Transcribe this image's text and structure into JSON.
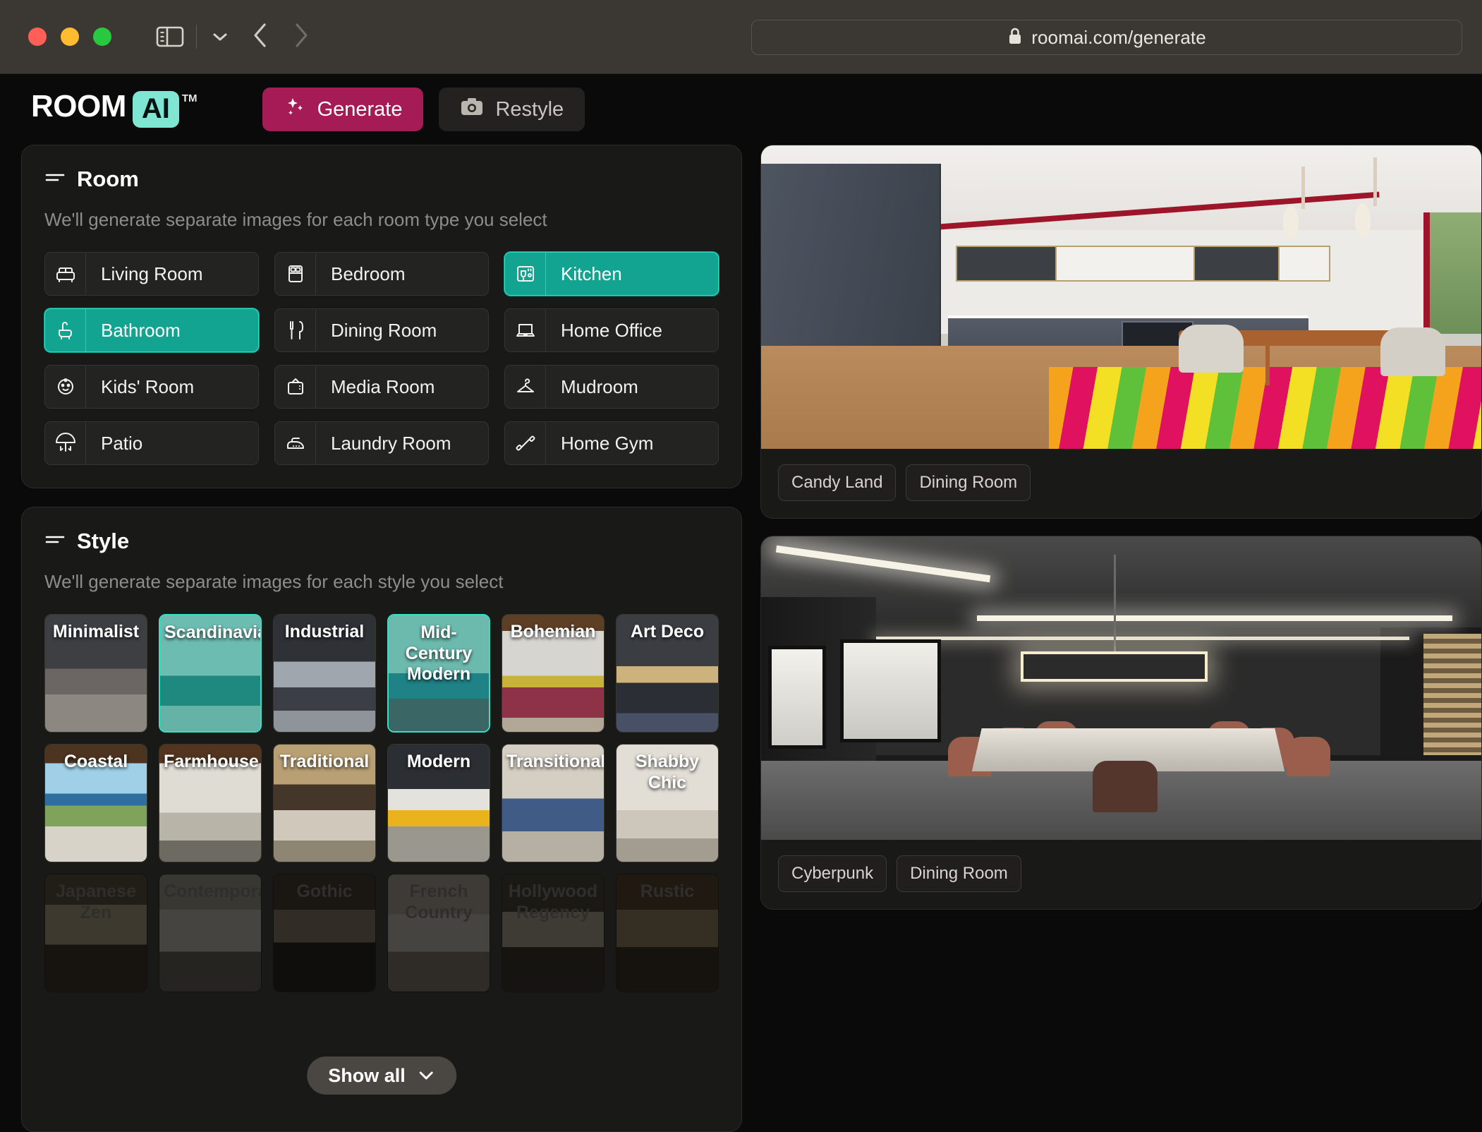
{
  "browser": {
    "url": "roomai.com/generate",
    "lock_icon": "lock-icon",
    "back_icon": "chevron-left-icon",
    "forward_icon": "chevron-right-icon",
    "sidebar_icon": "sidebar-toggle-icon",
    "dropdown_icon": "chevron-down-icon"
  },
  "header": {
    "logo_word": "ROOM",
    "logo_badge": "AI",
    "logo_tm": "TM",
    "tabs": [
      {
        "label": "Generate",
        "icon": "sparkles-icon",
        "active": true
      },
      {
        "label": "Restyle",
        "icon": "camera-icon",
        "active": false
      }
    ]
  },
  "room_section": {
    "title": "Room",
    "icon": "list-lines-icon",
    "subtitle": "We'll generate separate images for each room type you select",
    "items": [
      {
        "label": "Living Room",
        "icon": "sofa-icon",
        "selected": false
      },
      {
        "label": "Bedroom",
        "icon": "bed-icon",
        "selected": false
      },
      {
        "label": "Kitchen",
        "icon": "kitchen-icon",
        "selected": true
      },
      {
        "label": "Bathroom",
        "icon": "bathtub-icon",
        "selected": true
      },
      {
        "label": "Dining Room",
        "icon": "cutlery-icon",
        "selected": false
      },
      {
        "label": "Home Office",
        "icon": "laptop-icon",
        "selected": false
      },
      {
        "label": "Kids' Room",
        "icon": "baby-icon",
        "selected": false
      },
      {
        "label": "Media Room",
        "icon": "tv-icon",
        "selected": false
      },
      {
        "label": "Mudroom",
        "icon": "hanger-icon",
        "selected": false
      },
      {
        "label": "Patio",
        "icon": "parasol-icon",
        "selected": false
      },
      {
        "label": "Laundry Room",
        "icon": "iron-icon",
        "selected": false
      },
      {
        "label": "Home Gym",
        "icon": "dumbbell-icon",
        "selected": false
      }
    ]
  },
  "style_section": {
    "title": "Style",
    "icon": "list-lines-icon",
    "subtitle": "We'll generate separate images for each style you select",
    "show_all": {
      "label": "Show all",
      "icon": "chevron-down-icon"
    },
    "rows": [
      {
        "dimmed": false,
        "items": [
          {
            "label": "Minimalist",
            "selected": false,
            "art": "minimalist"
          },
          {
            "label": "Scandinavian",
            "selected": true,
            "art": "scandinavian"
          },
          {
            "label": "Industrial",
            "selected": false,
            "art": "industrial"
          },
          {
            "label": "Mid-Century Modern",
            "selected": true,
            "art": "midcentury"
          },
          {
            "label": "Bohemian",
            "selected": false,
            "art": "bohemian"
          },
          {
            "label": "Art Deco",
            "selected": false,
            "art": "artdeco"
          }
        ]
      },
      {
        "dimmed": false,
        "items": [
          {
            "label": "Coastal",
            "selected": false,
            "art": "coastal"
          },
          {
            "label": "Farmhouse",
            "selected": false,
            "art": "farmhouse"
          },
          {
            "label": "Traditional",
            "selected": false,
            "art": "traditional"
          },
          {
            "label": "Modern",
            "selected": false,
            "art": "modern"
          },
          {
            "label": "Transitional",
            "selected": false,
            "art": "transitional"
          },
          {
            "label": "Shabby Chic",
            "selected": false,
            "art": "shabbychic"
          }
        ]
      },
      {
        "dimmed": true,
        "items": [
          {
            "label": "Japanese Zen",
            "selected": false,
            "art": "zen"
          },
          {
            "label": "Contemporary",
            "selected": false,
            "art": "contemporary"
          },
          {
            "label": "Gothic",
            "selected": false,
            "art": "gothic"
          },
          {
            "label": "French Country",
            "selected": false,
            "art": "french"
          },
          {
            "label": "Hollywood Regency",
            "selected": false,
            "art": "hollywood"
          },
          {
            "label": "Rustic",
            "selected": false,
            "art": "rustic"
          }
        ]
      }
    ]
  },
  "previews": [
    {
      "art": "kitchen-candyland",
      "tags": [
        "Candy Land",
        "Dining Room"
      ]
    },
    {
      "art": "cyberpunk-dining",
      "tags": [
        "Cyberpunk",
        "Dining Room"
      ]
    }
  ],
  "colors": {
    "accent_magenta": "#a51b55",
    "accent_teal": "#13a391",
    "logo_mint": "#7fe6d4",
    "panel_bg": "#191918",
    "app_bg": "#0a0a0a"
  }
}
